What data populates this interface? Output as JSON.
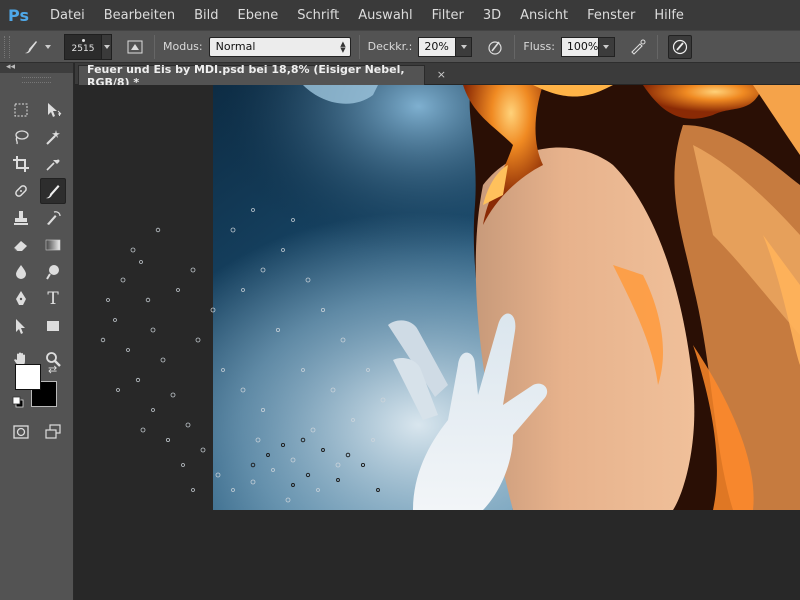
{
  "app": {
    "logo": "Ps"
  },
  "menu": [
    "Datei",
    "Bearbeiten",
    "Bild",
    "Ebene",
    "Schrift",
    "Auswahl",
    "Filter",
    "3D",
    "Ansicht",
    "Fenster",
    "Hilfe"
  ],
  "options": {
    "brush_size": "2515",
    "mode_label": "Modus:",
    "mode_value": "Normal",
    "opacity_label": "Deckkr.:",
    "opacity_value": "20%",
    "flow_label": "Fluss:",
    "flow_value": "100%"
  },
  "document": {
    "tab_title": "Feuer und Eis by MDI.psd bei 18,8% (Eisiger Nebel, RGB/8) *",
    "close_symbol": "×"
  },
  "toolbox": {
    "collapse_symbol": "◂◂",
    "tools": [
      [
        "marquee-icon",
        "move-icon"
      ],
      [
        "lasso-icon",
        "magic-wand-icon"
      ],
      [
        "crop-icon",
        "eyedropper-icon"
      ],
      [
        "healing-brush-icon",
        "brush-icon"
      ],
      [
        "clone-stamp-icon",
        "history-brush-icon"
      ],
      [
        "eraser-icon",
        "gradient-icon"
      ],
      [
        "blur-icon",
        "dodge-icon"
      ],
      [
        "pen-icon",
        "type-icon"
      ],
      [
        "path-selection-icon",
        "rectangle-shape-icon"
      ],
      [
        "hand-icon",
        "zoom-icon"
      ]
    ],
    "active_tool": "brush-icon",
    "type_tool_glyph": "T",
    "swap_symbol": "⇄",
    "foreground_color": "#ffffff",
    "background_color": "#000000"
  },
  "colors": {
    "menubar_bg": "#3a3a3a",
    "options_bg": "#535353",
    "panel_bg": "#535353",
    "canvas_bg": "#282828",
    "ps_blue": "#4fa8e8"
  }
}
